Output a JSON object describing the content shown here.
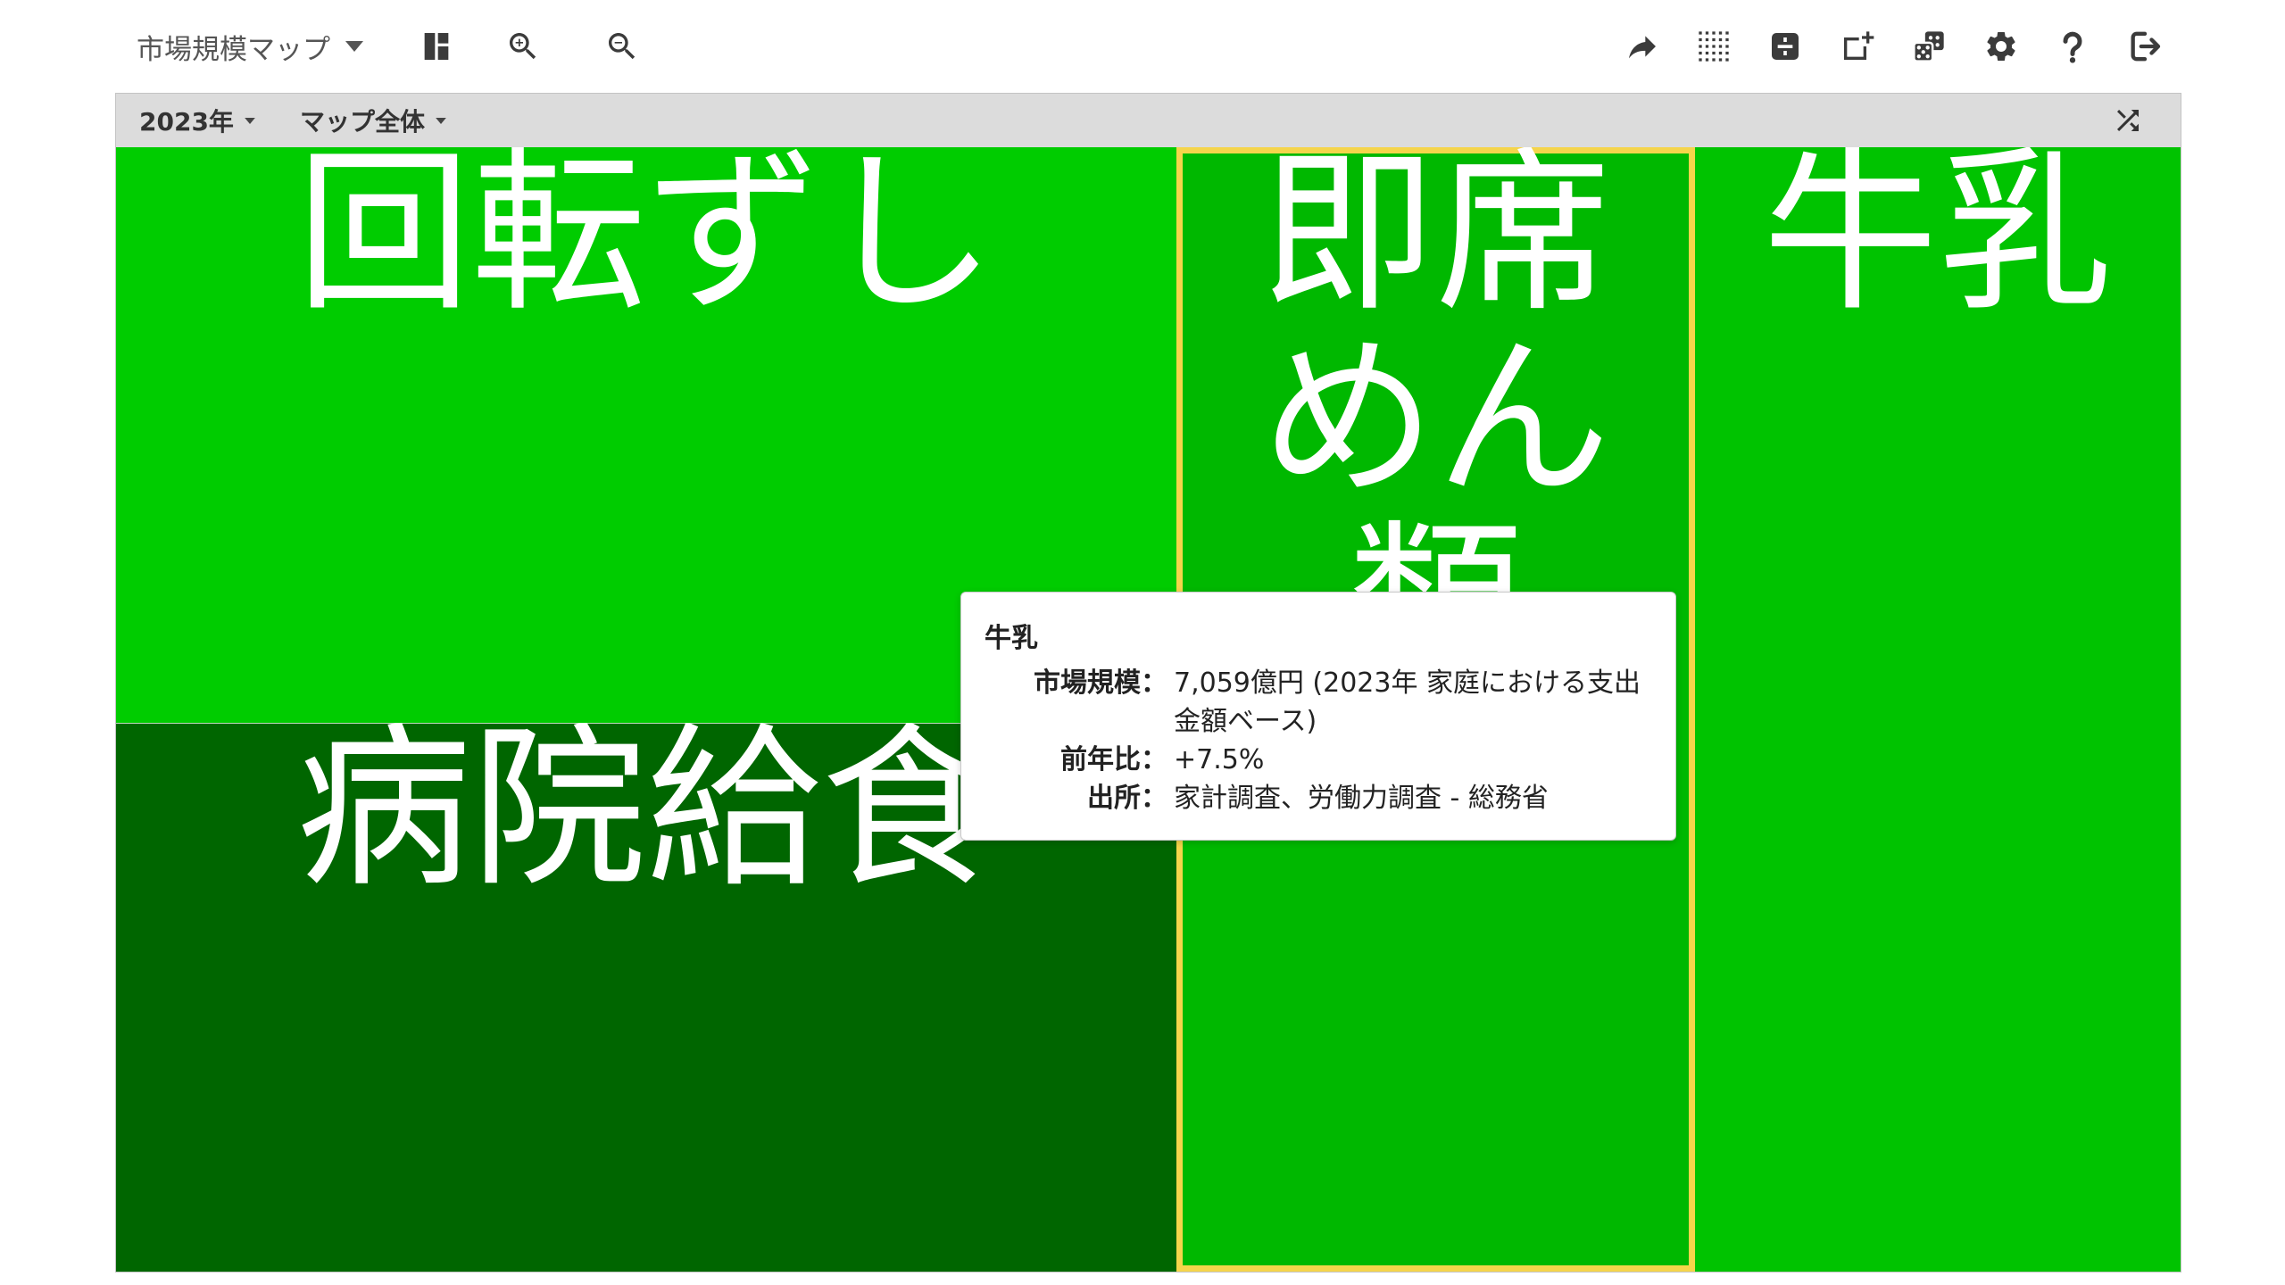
{
  "app": {
    "title": "市場規模マップ"
  },
  "toolbar": {
    "left_icons": [
      "layout-icon",
      "zoom-in-icon",
      "zoom-out-icon"
    ],
    "right_icons": [
      "share-icon",
      "grid-icon",
      "divide-box-icon",
      "add-box-icon",
      "dice-icon",
      "gear-icon",
      "help-icon",
      "logout-icon"
    ]
  },
  "filter_bar": {
    "year": "2023年",
    "scope": "マップ全体",
    "right_icon": "shuffle-icon"
  },
  "treemap": {
    "tiles": [
      {
        "label": "回転ずし",
        "color": "#00cc00",
        "selected": false
      },
      {
        "label": "病院給食",
        "color": "#006600",
        "selected": false
      },
      {
        "label": "即席めん類",
        "color": "#00b800",
        "selected": true
      },
      {
        "label": "牛乳",
        "color": "#00c300",
        "selected": false
      }
    ],
    "selected_border_color": "#f5d54b"
  },
  "tooltip": {
    "title": "牛乳",
    "rows": [
      {
        "label": "市場規模：",
        "value": "7,059億円 (2023年 家庭における支出金額ベース)"
      },
      {
        "label": "前年比：",
        "value": "+7.5%"
      },
      {
        "label": "出所：",
        "value": "家計調査、労働力調査 - 総務省"
      }
    ]
  },
  "colors": {
    "toolbar_icon": "#3b3b3b",
    "filter_bar_background": "#dcdcdc",
    "tile_label": "#ffffff"
  }
}
